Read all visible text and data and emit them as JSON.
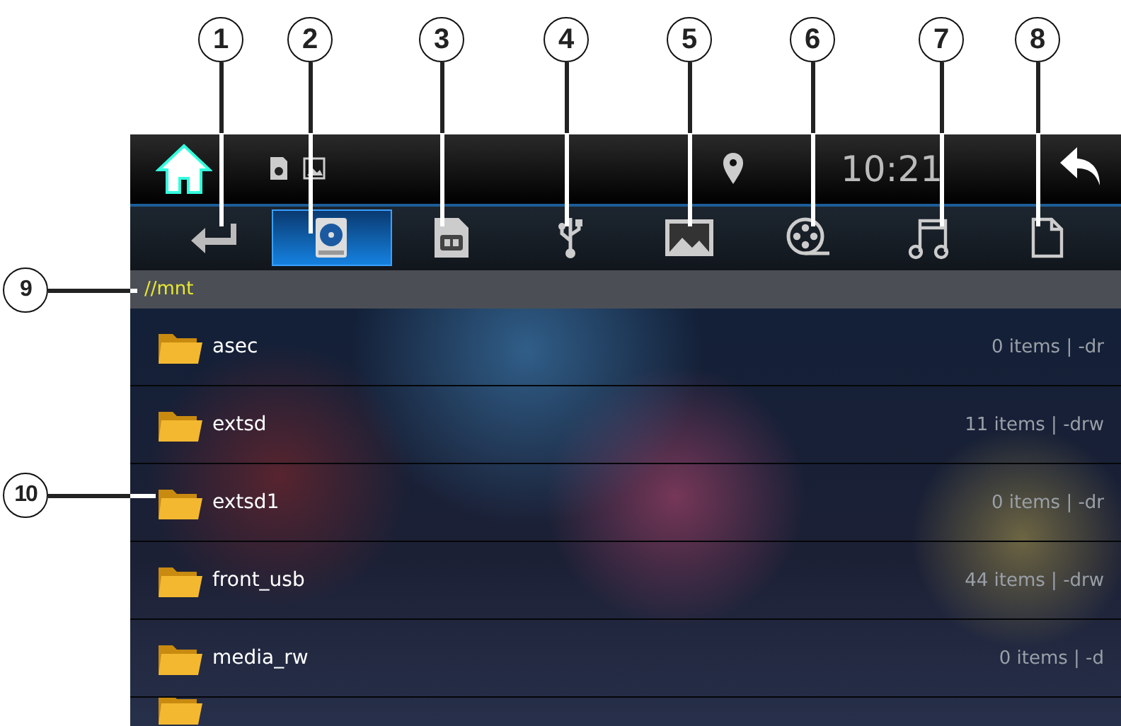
{
  "callouts": [
    {
      "label": "1"
    },
    {
      "label": "2"
    },
    {
      "label": "3"
    },
    {
      "label": "4"
    },
    {
      "label": "5"
    },
    {
      "label": "6"
    },
    {
      "label": "7"
    },
    {
      "label": "8"
    },
    {
      "label": "9"
    },
    {
      "label": "10"
    }
  ],
  "status_bar": {
    "time": "10:21"
  },
  "toolbar": [
    {
      "kind": "back",
      "selected": false
    },
    {
      "kind": "drive",
      "selected": true
    },
    {
      "kind": "sd",
      "selected": false
    },
    {
      "kind": "usb",
      "selected": false
    },
    {
      "kind": "image",
      "selected": false
    },
    {
      "kind": "video",
      "selected": false
    },
    {
      "kind": "music",
      "selected": false
    },
    {
      "kind": "file",
      "selected": false
    }
  ],
  "path": "//mnt",
  "rows": [
    {
      "name": "asec",
      "info": "0 items | -dr"
    },
    {
      "name": "extsd",
      "info": "11 items | -drw"
    },
    {
      "name": "extsd1",
      "info": "0 items | -dr"
    },
    {
      "name": "front_usb",
      "info": "44 items | -drw"
    },
    {
      "name": "media_rw",
      "info": "0 items | -d"
    }
  ]
}
